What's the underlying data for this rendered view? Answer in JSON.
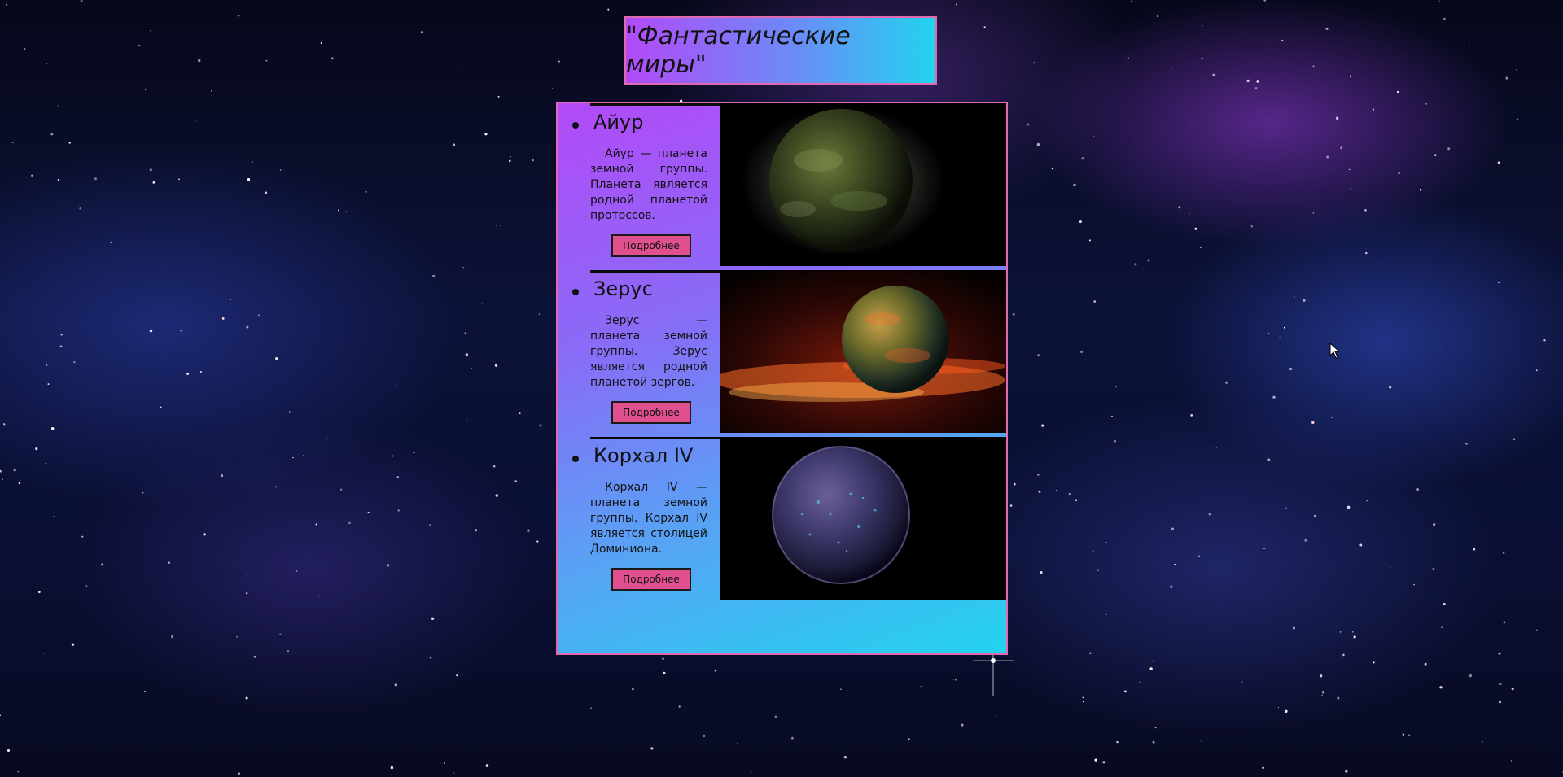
{
  "page": {
    "title": "\"Фантастические миры\""
  },
  "planets": [
    {
      "name": "Айур",
      "description": "Айур — планета земной группы. Планета является родной планетой протоссов.",
      "button_label": "Подробнее",
      "image": "planet-aiur-image"
    },
    {
      "name": "Зерус",
      "description": "Зерус — планета земной группы. Зерус является родной планетой зергов.",
      "button_label": "Подробнее",
      "image": "planet-zerus-image"
    },
    {
      "name": "Корхал IV",
      "description": "Корхал IV — планета земной группы. Корхал IV является столицей Доминиона.",
      "button_label": "Подробнее",
      "image": "planet-korhal-image"
    }
  ],
  "colors": {
    "title_gradient": [
      "#b24af7",
      "#22d3ee"
    ],
    "panel_border": "#e06ab0",
    "button_bg": "#e0508f"
  }
}
